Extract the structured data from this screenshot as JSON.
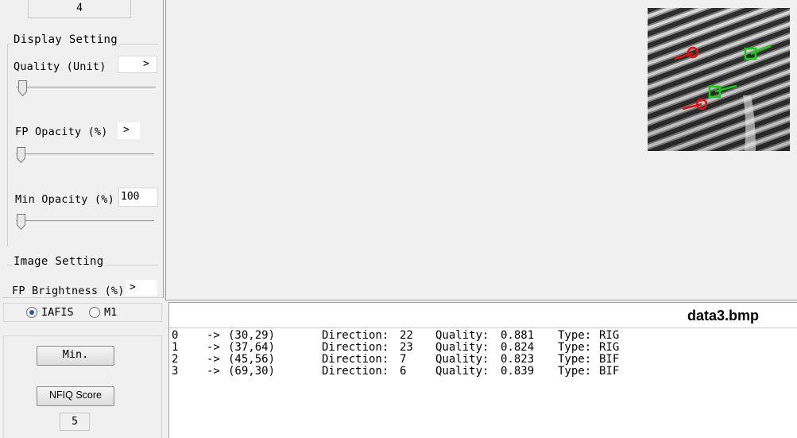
{
  "left": {
    "count_value": "4",
    "display_setting": {
      "title": "Display Setting",
      "quality_label": "Quality (Unit)",
      "quality_arrow": ">",
      "quality_slider": 0,
      "fp_opacity_label": "FP Opacity (%)",
      "fp_opacity_arrow": ">",
      "fp_opacity_slider": 0,
      "min_opacity_label": "Min Opacity (%)",
      "min_opacity_value": "100",
      "min_opacity_slider": 0
    },
    "image_setting": {
      "title": "Image Setting",
      "fp_brightness_label": "FP Brightness (%)",
      "fp_brightness_arrow": ">"
    },
    "radio": {
      "options": [
        "IAFIS",
        "M1"
      ],
      "selected": "IAFIS"
    },
    "min_button": "Min.",
    "nfiq_button": "NFIQ Score",
    "nfiq_value": "5"
  },
  "result": {
    "file_name": "data3.bmp",
    "minutiae": [
      {
        "idx": "0",
        "arrow": "->",
        "coord": "(30,29)",
        "dir_label": "Direction:",
        "dir": "22",
        "q_label": "Quality:",
        "quality": "0.881",
        "t_label": "Type:",
        "type": "RIG"
      },
      {
        "idx": "1",
        "arrow": "->",
        "coord": "(37,64)",
        "dir_label": "Direction:",
        "dir": "23",
        "q_label": "Quality:",
        "quality": "0.824",
        "t_label": "Type:",
        "type": "RIG"
      },
      {
        "idx": "2",
        "arrow": "->",
        "coord": "(45,56)",
        "dir_label": "Direction:",
        "dir": "7",
        "q_label": "Quality:",
        "quality": "0.823",
        "t_label": "Type:",
        "type": "BIF"
      },
      {
        "idx": "3",
        "arrow": "->",
        "coord": "(69,30)",
        "dir_label": "Direction:",
        "dir": "6",
        "q_label": "Quality:",
        "quality": "0.839",
        "t_label": "Type:",
        "type": "BIF"
      }
    ]
  },
  "colors": {
    "ridge_ending": "#e01010",
    "bifurcation": "#10d010",
    "radio_dot": "#2a5aa8"
  }
}
